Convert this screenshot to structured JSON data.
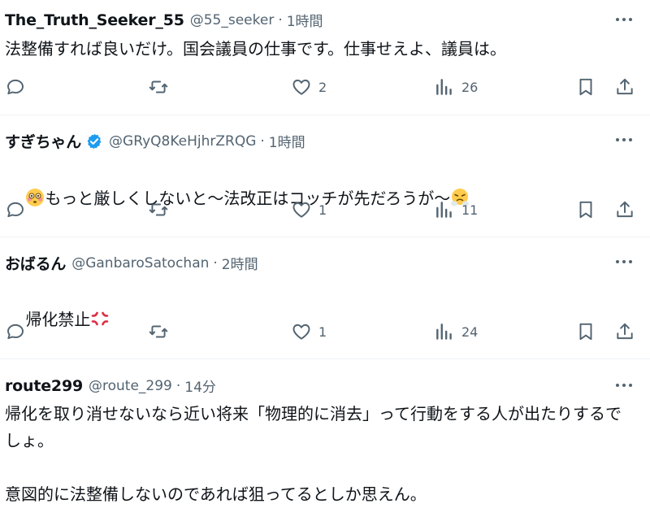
{
  "tweets": [
    {
      "name": "The_Truth_Seeker_55",
      "handle": "@55_seeker",
      "time": "1時間",
      "text": "法整備すれば良いだけ。国会議員の仕事です。仕事せえよ、議員は。",
      "likes": "2",
      "views": "26"
    },
    {
      "name": "すぎちゃん",
      "handle": "@GRyQ8KeHjhrZRQG",
      "time": "1時間",
      "verified": true,
      "text": "もっと厳しくしないと〜法改正はコッチが先だろうが〜",
      "emoji_lead": "flushed-face-emoji",
      "emoji_trail": "steam-nose-emoji",
      "likes": "1",
      "views": "11"
    },
    {
      "name": "おばるん",
      "handle": "@GanbaroSatochan",
      "time": "2時間",
      "text": "帰化禁止",
      "emoji_trail": "anger-symbol-emoji",
      "likes": "1",
      "views": "24"
    },
    {
      "name": "route299",
      "handle": "@route_299",
      "time": "14分",
      "text": "帰化を取り消せないなら近い将来「物理的に消去」って行動をする人が出たりするでしょ。\n\n意図的に法整備しないのであれば狙ってるとしか思えん。"
    }
  ],
  "separator": "·",
  "colors": {
    "text": "#0f1419",
    "secondary": "#536471",
    "verified": "#1d9bf0",
    "divider": "#eff3f4"
  }
}
